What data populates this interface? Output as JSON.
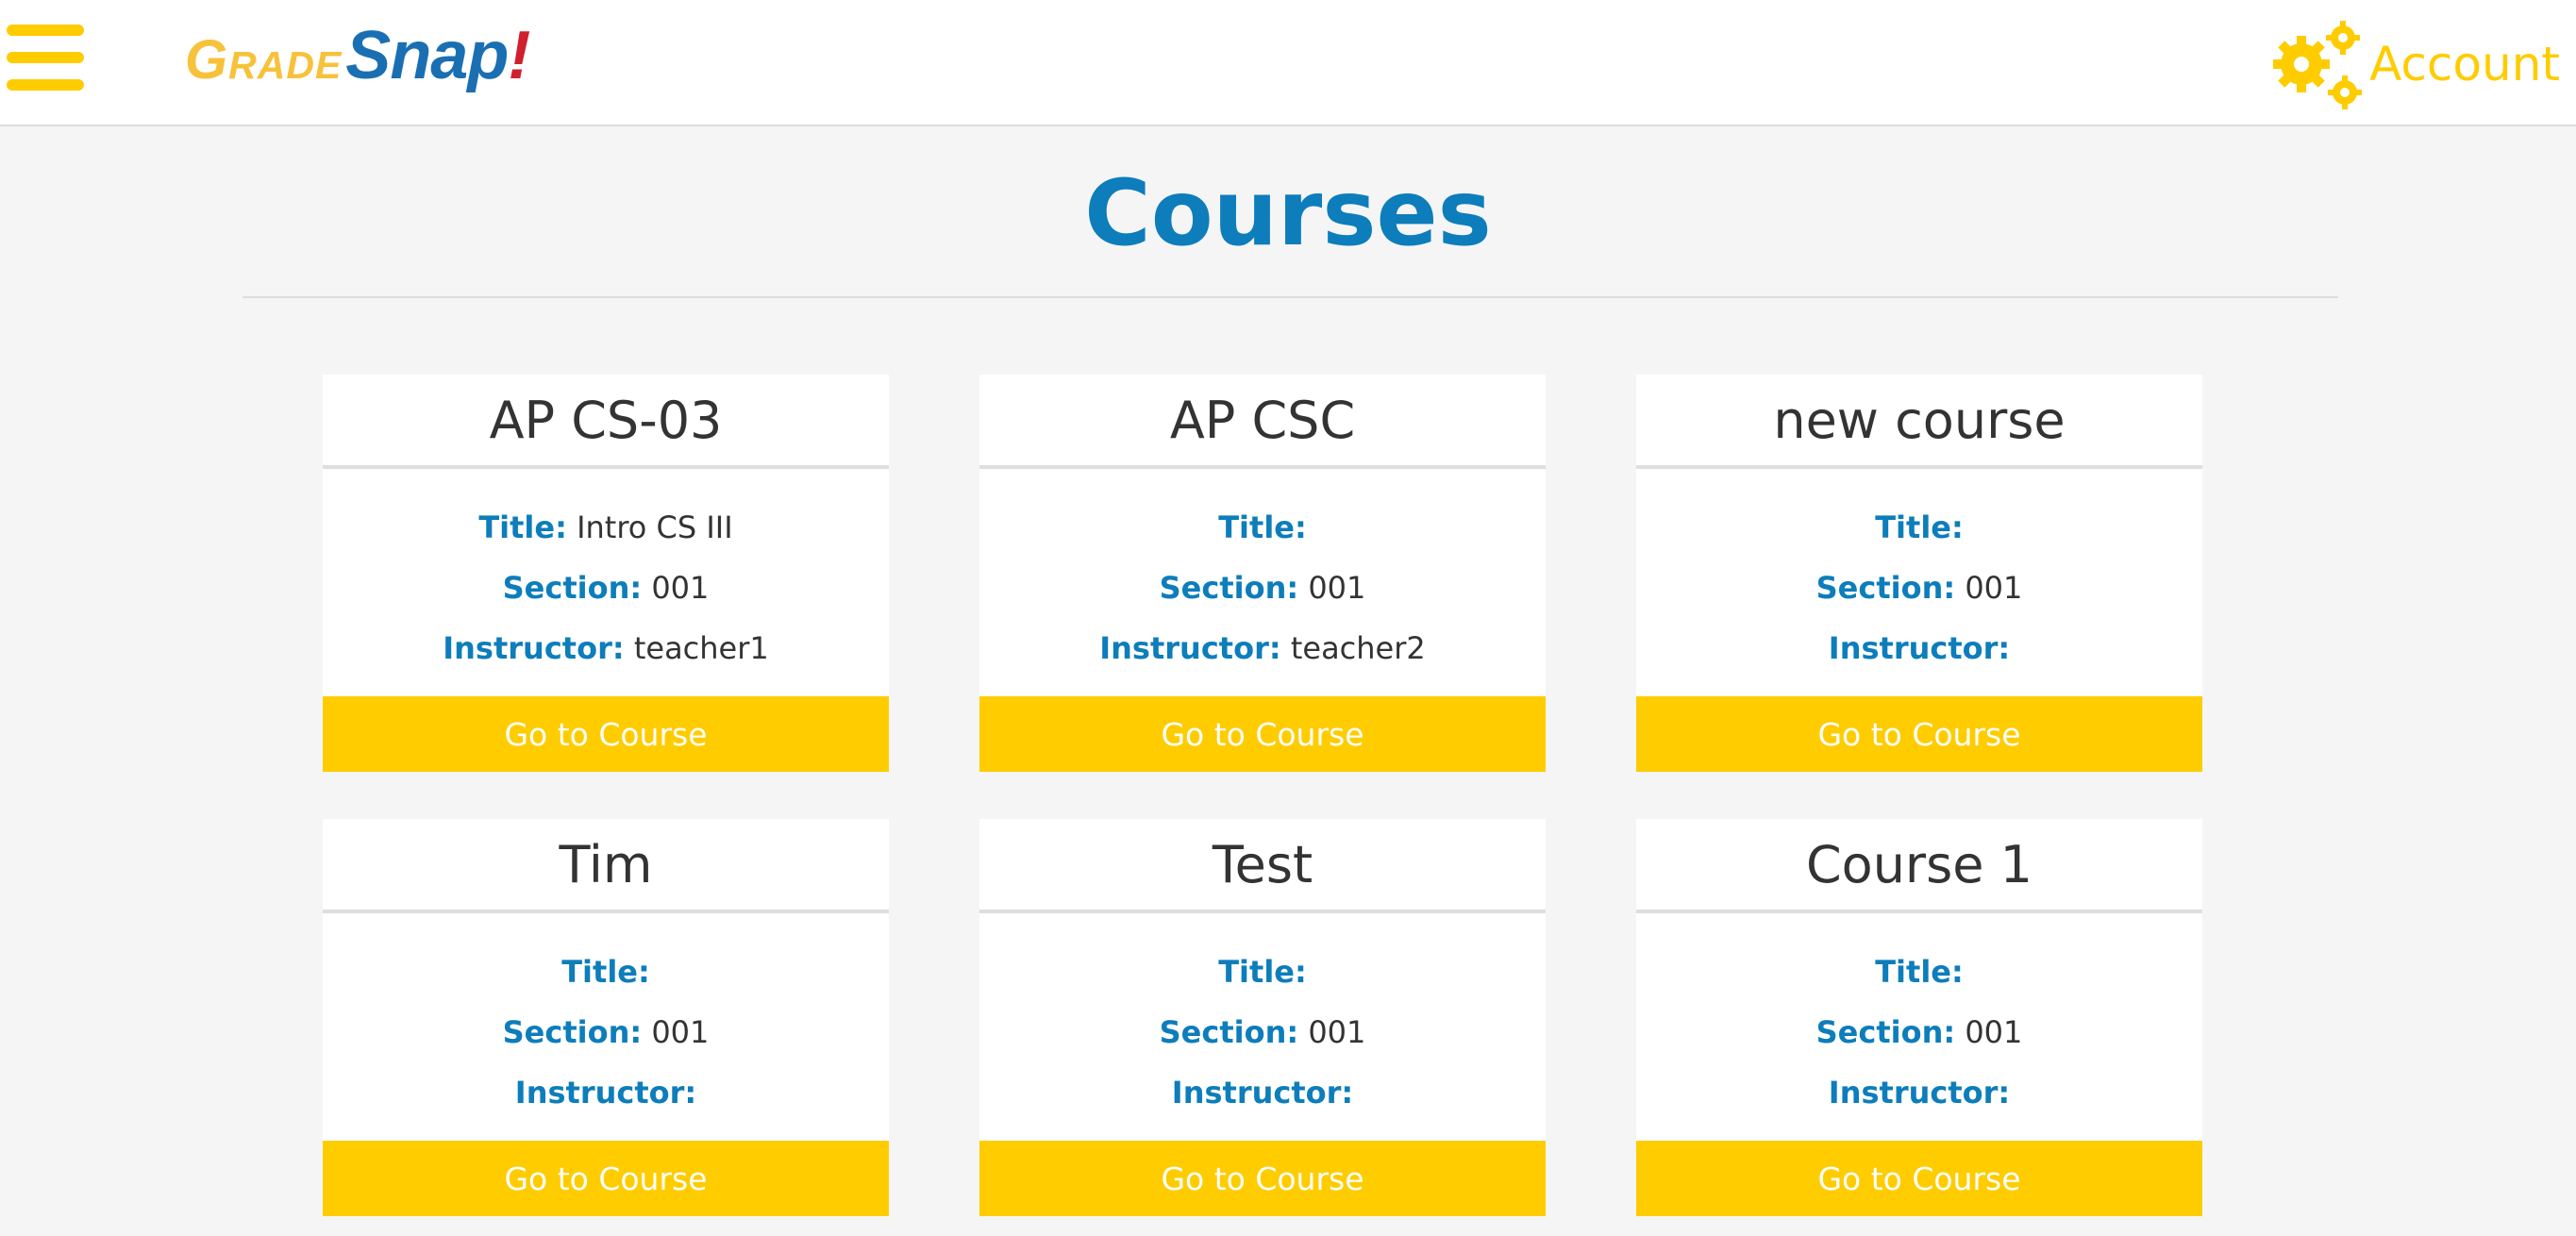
{
  "header": {
    "logo": {
      "part1": "Grade",
      "part2": "Snap",
      "part3": "!"
    },
    "account_label": "Account",
    "menu_icon": "hamburger-icon",
    "account_icon": "gears-icon",
    "accent_color": "#ffcc00"
  },
  "page_title": "Courses",
  "labels": {
    "title": "Title:",
    "section": "Section:",
    "instructor": "Instructor:"
  },
  "courses": [
    {
      "name": "AP CS-03",
      "title": "Intro CS III",
      "section": "001",
      "instructor": "teacher1",
      "button": "Go to Course"
    },
    {
      "name": "AP CSC",
      "title": "",
      "section": "001",
      "instructor": "teacher2",
      "button": "Go to Course"
    },
    {
      "name": "new course",
      "title": "",
      "section": "001",
      "instructor": "",
      "button": "Go to Course"
    },
    {
      "name": "Tim",
      "title": "",
      "section": "001",
      "instructor": "",
      "button": "Go to Course"
    },
    {
      "name": "Test",
      "title": "",
      "section": "001",
      "instructor": "",
      "button": "Go to Course"
    },
    {
      "name": "Course 1",
      "title": "",
      "section": "001",
      "instructor": "",
      "button": "Go to Course"
    }
  ]
}
